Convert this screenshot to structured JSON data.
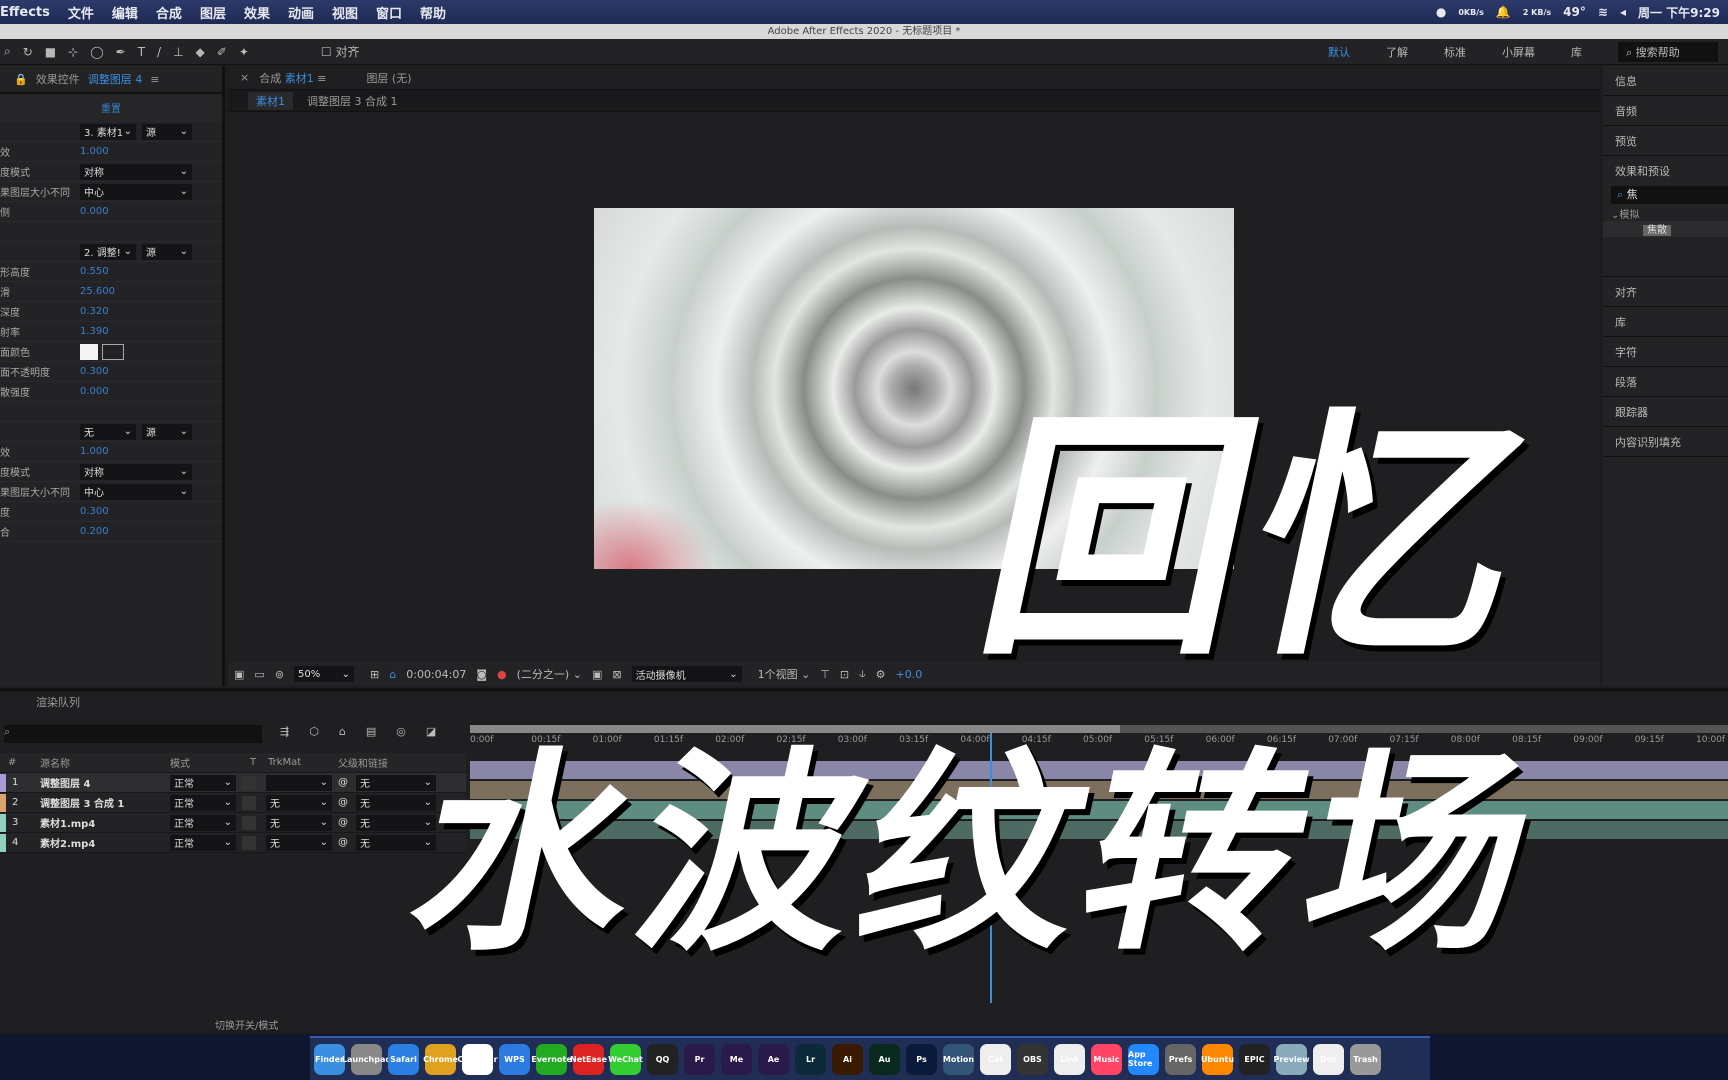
{
  "menubar": {
    "app": "Effects",
    "items": [
      "文件",
      "编辑",
      "合成",
      "图层",
      "效果",
      "动画",
      "视图",
      "窗口",
      "帮助"
    ],
    "net": "0KB/s",
    "net2": "2 KB/s",
    "temp": "49°",
    "clock": "周一 下午9:29"
  },
  "titlebar": "Adobe After Effects 2020 - 无标题项目 *",
  "toolbar": {
    "align": "对齐",
    "workspaces": [
      "默认",
      "了解",
      "标准",
      "小屏幕",
      "库"
    ],
    "search": "搜索帮助"
  },
  "effect_controls": {
    "tab": "效果控件",
    "layer": "调整图层 4",
    "reset": "重置",
    "rows": [
      {
        "label": "",
        "dd1": "3. 素材1",
        "dd2": "源"
      },
      {
        "label": "效",
        "value": "1.000"
      },
      {
        "label": "度模式",
        "dd1": "对称"
      },
      {
        "label": "果图层大小不同",
        "dd1": "中心"
      },
      {
        "label": "侧",
        "value": "0.000"
      },
      {
        "label": ""
      },
      {
        "label": "",
        "dd1": "2. 调整!",
        "dd2": "源"
      },
      {
        "label": "形高度",
        "value": "0.550"
      },
      {
        "label": "滑",
        "value": "25.600"
      },
      {
        "label": "深度",
        "value": "0.320"
      },
      {
        "label": "射率",
        "value": "1.390"
      },
      {
        "label": "面颜色",
        "swatch": true
      },
      {
        "label": "面不透明度",
        "value": "0.300"
      },
      {
        "label": "散强度",
        "value": "0.000"
      },
      {
        "label": ""
      },
      {
        "label": "",
        "dd1": "无",
        "dd2": "源"
      },
      {
        "label": "效",
        "value": "1.000"
      },
      {
        "label": "度模式",
        "dd1": "对称"
      },
      {
        "label": "果图层大小不同",
        "dd1": "中心"
      },
      {
        "label": "度",
        "value": "0.300"
      },
      {
        "label": "合",
        "value": "0.200"
      }
    ]
  },
  "composition": {
    "tab": "合成",
    "comp": "素材1",
    "layer_tab": "图层 (无)",
    "breadcrumb": [
      "素材1",
      "调整图层 3 合成 1"
    ]
  },
  "viewer_toolbar": {
    "zoom": "50%",
    "timecode": "0:00:04:07",
    "resolution": "(二分之一)",
    "camera": "活动摄像机",
    "views": "1个视图",
    "exposure": "+0.0"
  },
  "right_panel": {
    "items": [
      "信息",
      "音频",
      "预览",
      "效果和预设"
    ],
    "search": "焦",
    "group": "模拟",
    "result": "焦散",
    "items2": [
      "对齐",
      "库",
      "字符",
      "段落",
      "跟踪器",
      "内容识别填充"
    ]
  },
  "timeline": {
    "render_queue": "渲染队列",
    "headers": [
      "#",
      "源名称",
      "模式",
      "T",
      "TrkMat",
      "父级和链接"
    ],
    "layers": [
      {
        "num": "1",
        "name": "调整图层 4",
        "mode": "正常",
        "trkmat": "",
        "parent": "无",
        "color": "#a99ad8"
      },
      {
        "num": "2",
        "name": "调整图层 3 合成 1",
        "mode": "正常",
        "trkmat": "无",
        "parent": "无",
        "color": "#d9a56a"
      },
      {
        "num": "3",
        "name": "素材1.mp4",
        "mode": "正常",
        "trkmat": "无",
        "parent": "无",
        "color": "#8fd0bd"
      },
      {
        "num": "4",
        "name": "素材2.mp4",
        "mode": "正常",
        "trkmat": "无",
        "parent": "无",
        "color": "#8fd0bd"
      }
    ],
    "ruler": [
      "0:00f",
      "00:15f",
      "01:00f",
      "01:15f",
      "02:00f",
      "02:15f",
      "03:00f",
      "03:15f",
      "04:00f",
      "04:15f",
      "05:00f",
      "05:15f",
      "06:00f",
      "06:15f",
      "07:00f",
      "07:15f",
      "08:00f",
      "08:15f",
      "09:00f",
      "09:15f",
      "10:00f"
    ],
    "toggle": "切换开关/模式"
  },
  "overlay": {
    "line1": "回忆",
    "line2": "水波纹转场"
  },
  "dock": [
    "Finder",
    "Launchpad",
    "Safari",
    "Chrome",
    "Calendar",
    "WPS",
    "Evernote",
    "NetEase",
    "WeChat",
    "QQ",
    "Pr",
    "Me",
    "Ae",
    "Lr",
    "Ai",
    "Au",
    "Ps",
    "Motion",
    "Cat",
    "OBS",
    "Link",
    "Music",
    "App Store",
    "Prefs",
    "Ubuntu",
    "EPIC",
    "Preview",
    "Doc",
    "Trash"
  ]
}
